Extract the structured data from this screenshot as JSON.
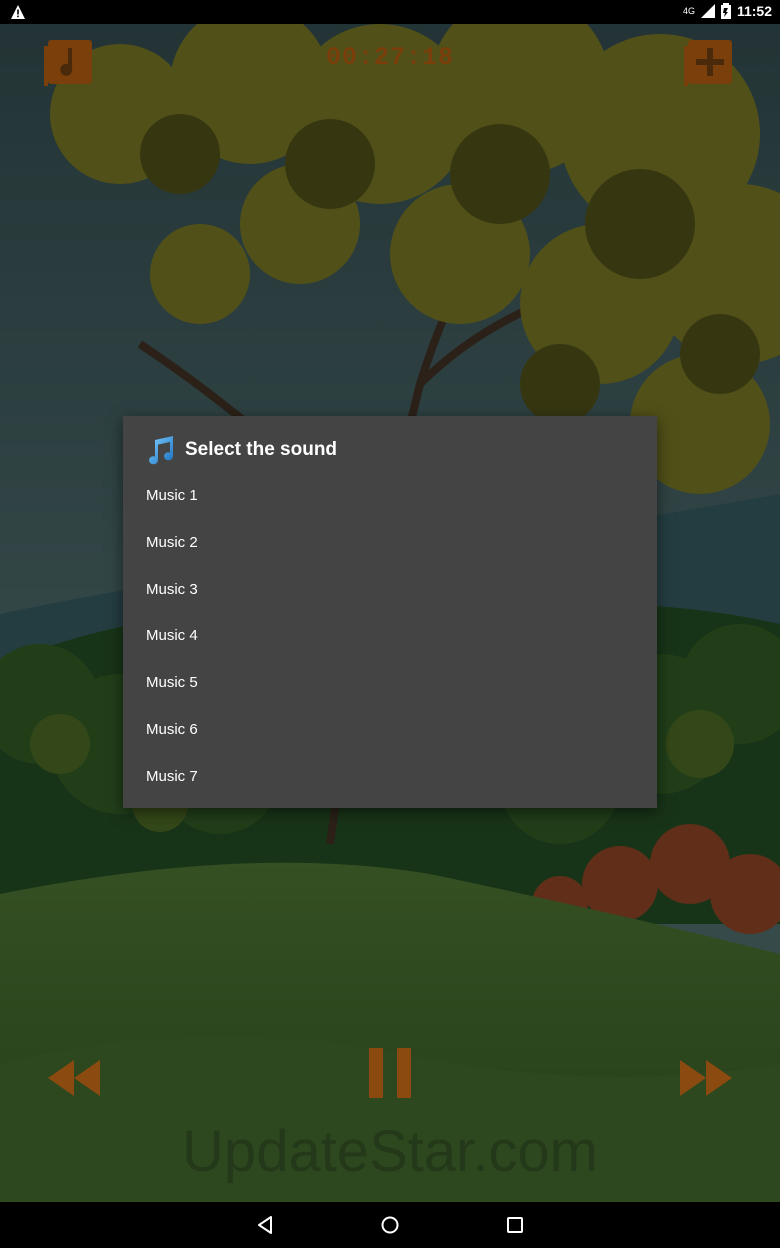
{
  "status_bar": {
    "network": "4G",
    "time": "11:52"
  },
  "player": {
    "timer": "00:27:18",
    "watermark": "UpdateStar.com"
  },
  "dialog": {
    "title": "Select the sound",
    "items": [
      "Music 1",
      "Music 2",
      "Music 3",
      "Music 4",
      "Music 5",
      "Music 6",
      "Music 7"
    ]
  },
  "colors": {
    "accent": "#c25a0a",
    "dialog_bg": "#444444"
  }
}
